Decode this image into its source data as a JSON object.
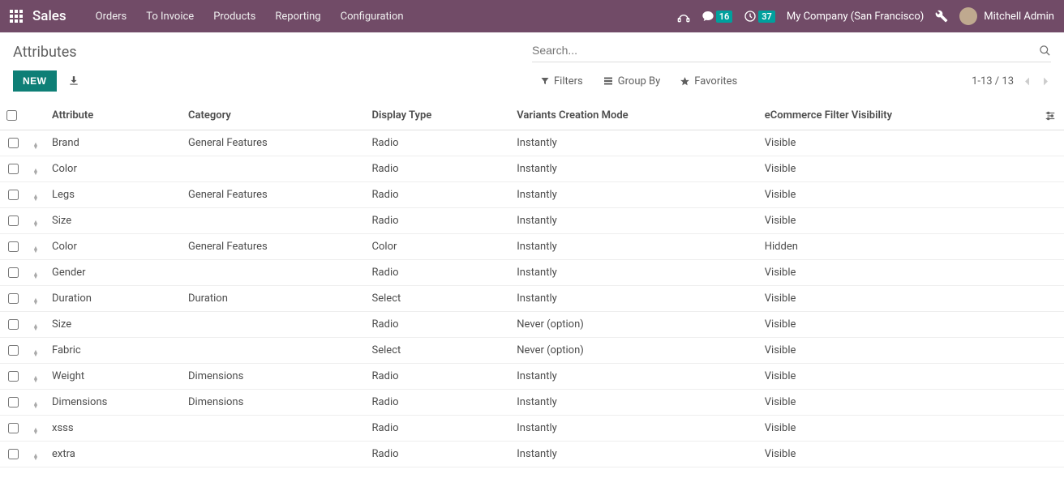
{
  "topbar": {
    "brand": "Sales",
    "nav": [
      "Orders",
      "To Invoice",
      "Products",
      "Reporting",
      "Configuration"
    ],
    "messages_badge": "16",
    "activities_badge": "37",
    "company": "My Company (San Francisco)",
    "user": "Mitchell Admin"
  },
  "breadcrumb": "Attributes",
  "search": {
    "placeholder": "Search..."
  },
  "buttons": {
    "new": "NEW"
  },
  "filters": {
    "filters": "Filters",
    "groupby": "Group By",
    "favorites": "Favorites"
  },
  "pager": {
    "range": "1-13 / 13"
  },
  "columns": {
    "attribute": "Attribute",
    "category": "Category",
    "display_type": "Display Type",
    "variants_mode": "Variants Creation Mode",
    "ecom_visibility": "eCommerce Filter Visibility"
  },
  "rows": [
    {
      "attribute": "Brand",
      "category": "General Features",
      "display_type": "Radio",
      "variants_mode": "Instantly",
      "ecom": "Visible"
    },
    {
      "attribute": "Color",
      "category": "",
      "display_type": "Radio",
      "variants_mode": "Instantly",
      "ecom": "Visible"
    },
    {
      "attribute": "Legs",
      "category": "General Features",
      "display_type": "Radio",
      "variants_mode": "Instantly",
      "ecom": "Visible"
    },
    {
      "attribute": "Size",
      "category": "",
      "display_type": "Radio",
      "variants_mode": "Instantly",
      "ecom": "Visible"
    },
    {
      "attribute": "Color",
      "category": "General Features",
      "display_type": "Color",
      "variants_mode": "Instantly",
      "ecom": "Hidden"
    },
    {
      "attribute": "Gender",
      "category": "",
      "display_type": "Radio",
      "variants_mode": "Instantly",
      "ecom": "Visible"
    },
    {
      "attribute": "Duration",
      "category": "Duration",
      "display_type": "Select",
      "variants_mode": "Instantly",
      "ecom": "Visible"
    },
    {
      "attribute": "Size",
      "category": "",
      "display_type": "Radio",
      "variants_mode": "Never (option)",
      "ecom": "Visible"
    },
    {
      "attribute": "Fabric",
      "category": "",
      "display_type": "Select",
      "variants_mode": "Never (option)",
      "ecom": "Visible"
    },
    {
      "attribute": "Weight",
      "category": "Dimensions",
      "display_type": "Radio",
      "variants_mode": "Instantly",
      "ecom": "Visible"
    },
    {
      "attribute": "Dimensions",
      "category": "Dimensions",
      "display_type": "Radio",
      "variants_mode": "Instantly",
      "ecom": "Visible"
    },
    {
      "attribute": "xsss",
      "category": "",
      "display_type": "Radio",
      "variants_mode": "Instantly",
      "ecom": "Visible"
    },
    {
      "attribute": "extra",
      "category": "",
      "display_type": "Radio",
      "variants_mode": "Instantly",
      "ecom": "Visible"
    }
  ]
}
